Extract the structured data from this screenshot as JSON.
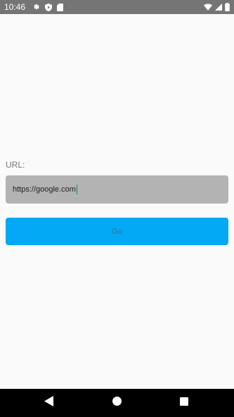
{
  "status_bar": {
    "time": "10:46",
    "left_icons": [
      "settings-icon",
      "play-protect-icon",
      "sd-card-icon"
    ],
    "right_icons": [
      "wifi-icon",
      "cellular-signal-icon",
      "battery-icon"
    ]
  },
  "form": {
    "url_label": "URL:",
    "url_value": "https://google.com",
    "go_label": "Go"
  },
  "nav_bar": {
    "icons": [
      "back-icon",
      "home-icon",
      "recents-icon"
    ]
  },
  "colors": {
    "status_bar": "#757575",
    "background": "#fafafa",
    "field_background": "#b3b3b3",
    "button_background": "#03a9f4",
    "nav_bar": "#000000",
    "caret": "#00897b"
  }
}
